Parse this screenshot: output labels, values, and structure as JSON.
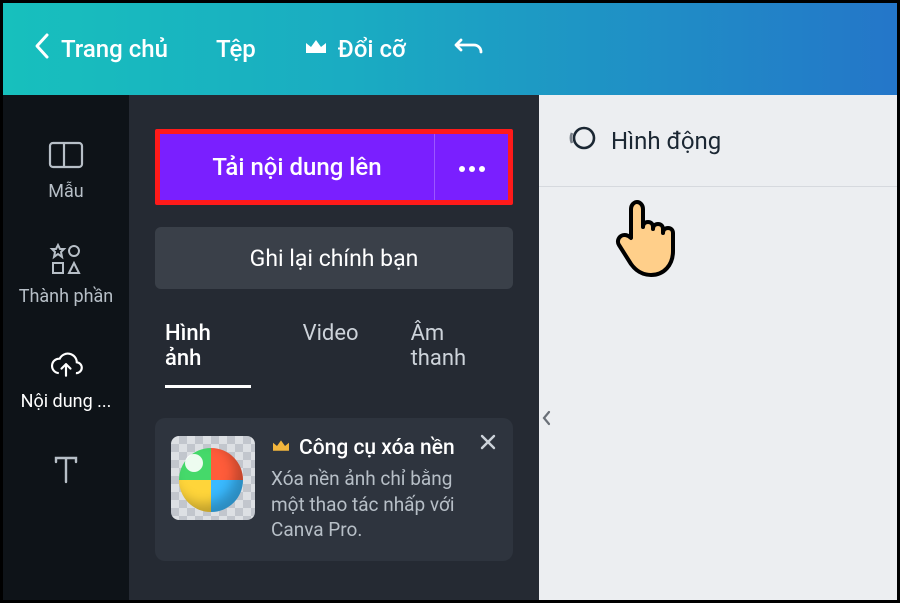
{
  "topbar": {
    "home_label": "Trang chủ",
    "file_label": "Tệp",
    "resize_label": "Đổi cỡ"
  },
  "sidebar": {
    "templates_label": "Mẫu",
    "elements_label": "Thành phần",
    "uploads_label": "Nội dung ..."
  },
  "panel": {
    "upload_label": "Tải nội dung lên",
    "record_label": "Ghi lại chính bạn",
    "tabs": {
      "images": "Hình ảnh",
      "video": "Video",
      "audio": "Âm thanh"
    },
    "promo": {
      "title": "Công cụ xóa nền",
      "description": "Xóa nền ảnh chỉ bằng một thao tác nhấp với Canva Pro."
    }
  },
  "right": {
    "animate_label": "Hình động"
  }
}
